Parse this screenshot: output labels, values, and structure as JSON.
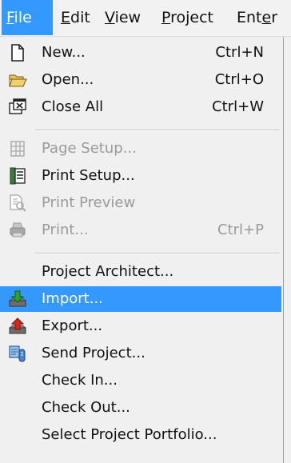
{
  "menubar": {
    "items": [
      {
        "label_mn": "F",
        "label_rest": "ile"
      },
      {
        "label_mn": "E",
        "label_rest": "dit"
      },
      {
        "label_mn": "V",
        "label_rest": "iew"
      },
      {
        "label_mn": "P",
        "label_rest": "roject"
      },
      {
        "label_pre": "Ent",
        "label_mn": "e",
        "label_rest": "r"
      }
    ]
  },
  "file_menu": {
    "new": {
      "label": "New...",
      "shortcut": "Ctrl+N",
      "icon": "new-document-icon"
    },
    "open": {
      "label": "Open...",
      "shortcut": "Ctrl+O",
      "icon": "open-folder-icon"
    },
    "close_all": {
      "label": "Close All",
      "shortcut": "Ctrl+W",
      "icon": "close-all-icon"
    },
    "page_setup": {
      "label": "Page Setup...",
      "icon": "page-setup-icon",
      "disabled": true
    },
    "print_setup": {
      "label": "Print Setup...",
      "icon": "print-setup-icon"
    },
    "print_preview": {
      "label": "Print Preview",
      "icon": "print-preview-icon",
      "disabled": true
    },
    "print": {
      "label": "Print...",
      "shortcut": "Ctrl+P",
      "icon": "printer-icon",
      "disabled": true
    },
    "project_architect": {
      "label": "Project Architect..."
    },
    "import": {
      "label": "Import...",
      "icon": "import-icon",
      "highlighted": true
    },
    "export": {
      "label": "Export...",
      "icon": "export-icon"
    },
    "send_project": {
      "label": "Send Project...",
      "icon": "send-project-icon"
    },
    "check_in": {
      "label": "Check In..."
    },
    "check_out": {
      "label": "Check Out..."
    },
    "select_portfolio": {
      "label": "Select Project Portfolio..."
    }
  },
  "colors": {
    "highlight": "#3399ff",
    "disabled_text": "#9a9a9a"
  }
}
